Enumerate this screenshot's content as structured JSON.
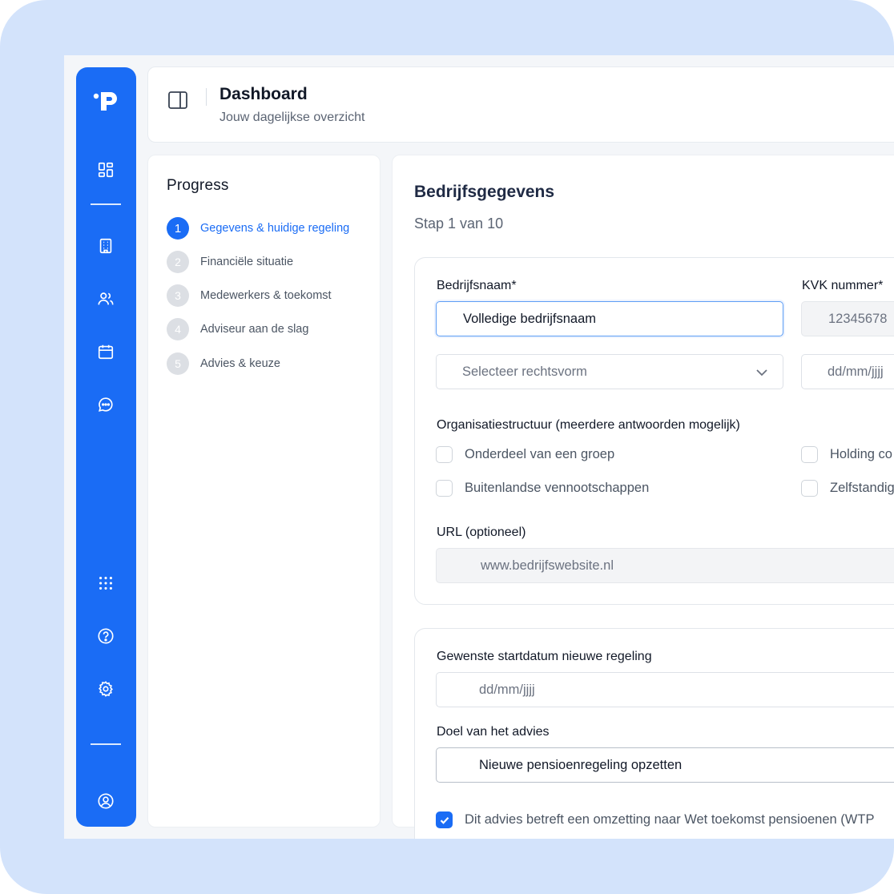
{
  "header": {
    "title": "Dashboard",
    "subtitle": "Jouw dagelijkse overzicht"
  },
  "sidebar": {
    "logo_icon": "p-logo-icon",
    "items": [
      {
        "icon": "dashboard-grid-icon"
      },
      {
        "icon": "building-icon"
      },
      {
        "icon": "users-icon"
      },
      {
        "icon": "calendar-icon"
      },
      {
        "icon": "chat-icon"
      },
      {
        "icon": "apps-grid-icon"
      },
      {
        "icon": "help-icon"
      },
      {
        "icon": "settings-icon"
      },
      {
        "icon": "user-profile-icon"
      }
    ]
  },
  "progress": {
    "title": "Progress",
    "steps": [
      {
        "num": "1",
        "label": "Gegevens & huidige regeling",
        "active": true
      },
      {
        "num": "2",
        "label": "Financiële situatie"
      },
      {
        "num": "3",
        "label": "Medewerkers & toekomst"
      },
      {
        "num": "4",
        "label": "Adviseur aan de slag"
      },
      {
        "num": "5",
        "label": "Advies & keuze"
      }
    ]
  },
  "form": {
    "title": "Bedrijfsgegevens",
    "step_text": "Stap 1 van 10",
    "company_name": {
      "label": "Bedrijfsnaam*",
      "value": "Volledige bedrijfsnaam"
    },
    "kvk": {
      "label": "KVK nummer*",
      "placeholder": "12345678"
    },
    "legal_form": {
      "placeholder": "Selecteer rechtsvorm"
    },
    "date_founded": {
      "placeholder": "dd/mm/jjjj"
    },
    "org_structure": {
      "label": "Organisatiestructuur (meerdere antwoorden mogelijk)",
      "options": [
        {
          "label": "Onderdeel van een groep",
          "checked": false
        },
        {
          "label": "Holding co",
          "checked": false
        },
        {
          "label": "Buitenlandse vennootschappen",
          "checked": false
        },
        {
          "label": "Zelfstandig",
          "checked": false
        }
      ]
    },
    "url": {
      "label": "URL (optioneel)",
      "placeholder": "www.bedrijfswebsite.nl"
    },
    "start_date": {
      "label": "Gewenste startdatum nieuwe regeling",
      "placeholder": "dd/mm/jjjj"
    },
    "goal": {
      "label": "Doel van het advies",
      "value": "Nieuwe pensioenregeling opzetten"
    },
    "wtp": {
      "label": "Dit advies betreft een omzetting naar Wet toekomst pensioenen (WTP",
      "checked": true
    }
  },
  "colors": {
    "accent": "#1a6cf5",
    "frame_bg": "#d3e3fb",
    "app_bg": "#f4f6f9"
  }
}
